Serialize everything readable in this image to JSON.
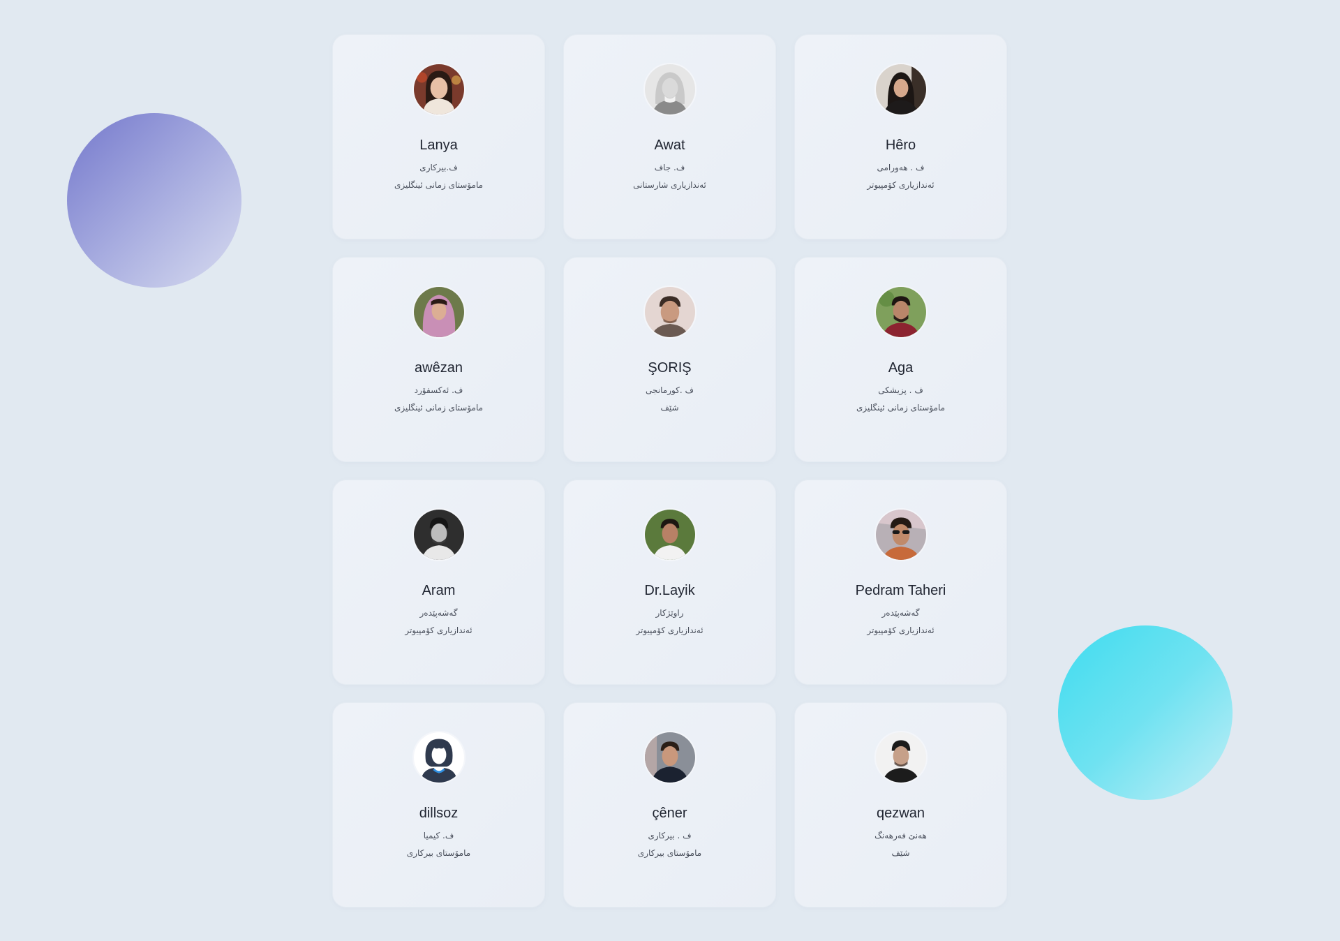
{
  "colors": {
    "background": "#e1e9f1",
    "card": "#edf1f7",
    "name_text": "#1f2430",
    "detail_text": "#4a505c",
    "blob_left_start": "#7478cc",
    "blob_right_start": "#3fdcef"
  },
  "decorations": {
    "left_blob": "purple-gradient-circle",
    "right_blob": "cyan-gradient-circle"
  },
  "members": [
    {
      "name": "Lanya",
      "role": "ف.بیرکاری",
      "subject": "مامۆستای زمانی ئینگلیزی",
      "avatar": "photo-woman-smiling-headscarf"
    },
    {
      "name": "Awat",
      "role": "ف. جاف",
      "subject": "ئەندازیاری شارستانی",
      "avatar": "photo-woman-grayscale"
    },
    {
      "name": "Hêro",
      "role": "ف . هەورامی",
      "subject": "ئەندازیاری کۆمپیوتر",
      "avatar": "photo-woman-dark-hair"
    },
    {
      "name": "awêzan",
      "role": "ف. ئەکسفۆرد",
      "subject": "مامۆستای زمانی ئینگلیزی",
      "avatar": "photo-woman-pink-headscarf"
    },
    {
      "name": "ŞORIŞ",
      "role": "ف .کورمانجی",
      "subject": "شێف",
      "avatar": "photo-man-light-background"
    },
    {
      "name": "Aga",
      "role": "ف . پزیشکی",
      "subject": "مامۆستای زمانی ئینگلیزی",
      "avatar": "photo-man-outdoors"
    },
    {
      "name": "Aram",
      "role": "گەشەپێدەر",
      "subject": "ئەندازیاری کۆمپیوتر",
      "avatar": "photo-man-black-and-white"
    },
    {
      "name": "Dr.Layik",
      "role": "راوێژکار",
      "subject": "ئەندازیاری کۆمپیوتر",
      "avatar": "photo-man-green-background"
    },
    {
      "name": "Pedram Taheri",
      "role": "گەشەپێدەر",
      "subject": "ئەندازیاری کۆمپیوتر",
      "avatar": "photo-man-sunglasses"
    },
    {
      "name": "dillsoz",
      "role": "ف. کیمیا",
      "subject": "مامۆستای بیرکاری",
      "avatar": "placeholder-woman-icon"
    },
    {
      "name": "çêner",
      "role": "ف . بیرکاری",
      "subject": "مامۆستای بیرکاری",
      "avatar": "photo-man-jacket"
    },
    {
      "name": "qezwan",
      "role": "هەنێ فەرهەنگ",
      "subject": "شێف",
      "avatar": "photo-man-black-shirt"
    }
  ]
}
